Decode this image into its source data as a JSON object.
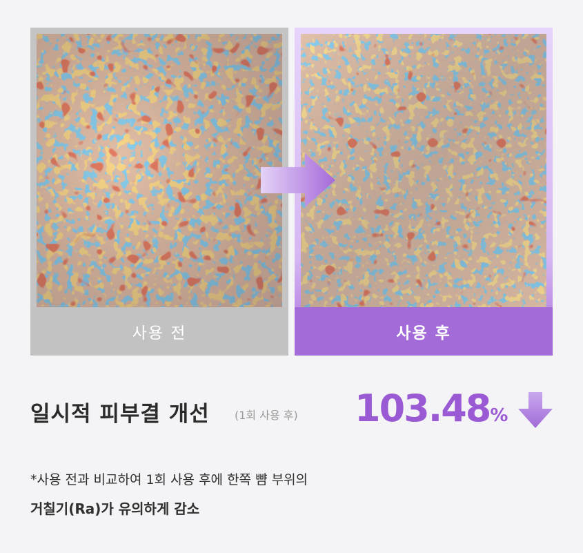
{
  "before_card": {
    "label": "사용 전"
  },
  "after_card": {
    "label": "사용 후"
  },
  "result": {
    "title": "일시적 피부결 개선",
    "note": "(1회 사용 후)",
    "value": "103.48",
    "unit": "%",
    "trend_icon": "down-arrow-icon"
  },
  "footnote": {
    "line1": "*사용 전과 비교하여 1회 사용 후에 한쪽 뺨 부위의",
    "line2": "거칠기(Ra)가 유의하게 감소"
  },
  "colors": {
    "accent": "#9a5ad4",
    "after_label_bg": "#a26bd8",
    "before_label_bg": "#c2c2c2",
    "background": "#f4f3f5"
  },
  "icons": {
    "transition": "right-arrow-icon"
  }
}
